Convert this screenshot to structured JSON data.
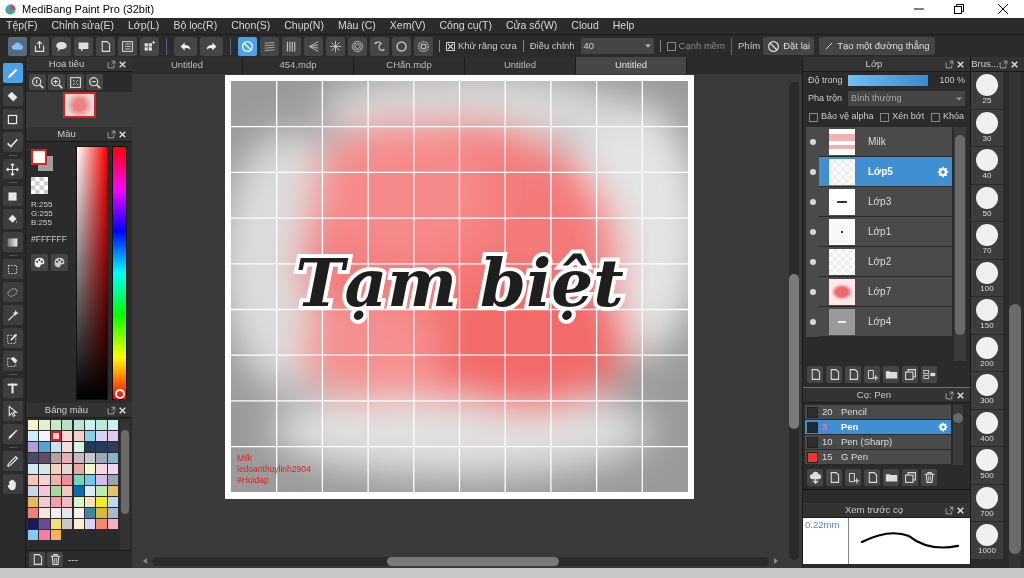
{
  "window": {
    "title": "MediBang Paint Pro (32bit)"
  },
  "menu": [
    "Tệp(F)",
    "Chỉnh sửa(E)",
    "Lớp(L)",
    "Bộ lọc(R)",
    "Chọn(S)",
    "Chụp(N)",
    "Màu (C)",
    "Xem(V)",
    "Công cụ(T)",
    "Cửa sổ(W)",
    "Cloud",
    "Help"
  ],
  "toolbar": {
    "rulers": [
      {
        "selected": true
      },
      {
        "selected": false
      },
      {
        "selected": false
      },
      {
        "selected": false
      },
      {
        "selected": false
      },
      {
        "selected": false
      },
      {
        "selected": false
      },
      {
        "selected": false
      },
      {
        "selected": false
      }
    ],
    "antialias": {
      "label": "Khử răng cưa",
      "checked": true
    },
    "adjust": {
      "label": "Điều chỉnh",
      "value": "40"
    },
    "soft_edge": {
      "label": "Cạnh mềm",
      "checked": false
    },
    "keys_label": "Phím",
    "reset_button": "Đặt lại",
    "line_button": "Tạo một đường thẳng"
  },
  "tools": [
    {
      "selected": true
    },
    {
      "selected": false
    },
    {
      "selected": false
    },
    {
      "selected": false
    },
    {
      "selected": false
    },
    {
      "selected": false
    },
    {
      "selected": false
    },
    {
      "selected": false
    },
    {
      "selected": false
    },
    {
      "selected": false
    },
    {
      "selected": false
    },
    {
      "selected": false
    },
    {
      "selected": false
    },
    {
      "selected": false
    },
    {
      "selected": false
    },
    {
      "selected": false
    },
    {
      "selected": false
    },
    {
      "selected": false
    }
  ],
  "navigator": {
    "title": "Hoa tiêu"
  },
  "color": {
    "title": "Màu",
    "r": "R:255",
    "g": "G:255",
    "b": "B:255",
    "hex": "#FFFFFF",
    "hue_slider": {
      "level": 0
    }
  },
  "palette": {
    "title": "Bảng màu",
    "footer": "---",
    "swatches": [
      {
        "color": "#fbf6c9",
        "selected": false
      },
      {
        "color": "#e3f0cf",
        "selected": false
      },
      {
        "color": "#cde8c6",
        "selected": false
      },
      {
        "color": "#b8e0c4",
        "selected": false
      },
      {
        "color": "#bfe6cf",
        "selected": false
      },
      {
        "color": "#c9f1f4",
        "selected": false
      },
      {
        "color": "#b9e9d8",
        "selected": false
      },
      {
        "color": "#cdeef5",
        "selected": false
      },
      {
        "color": "#cdeef9",
        "selected": false
      },
      {
        "color": "#f7f0f8",
        "selected": false
      },
      {
        "color": "#f9d0de",
        "selected": true
      },
      {
        "color": "#f9d9d9",
        "selected": false
      },
      {
        "color": "#f6cfcf",
        "selected": false
      },
      {
        "color": "#8ad0ec",
        "selected": false
      },
      {
        "color": "#d9d2f2",
        "selected": false
      },
      {
        "color": "#e5c8f0",
        "selected": false
      },
      {
        "color": "#b0a0d8",
        "selected": false
      },
      {
        "color": "#4fa4d9",
        "selected": false
      },
      {
        "color": "#c4e4f5",
        "selected": false
      },
      {
        "color": "#f6d8e2",
        "selected": false
      },
      {
        "color": "#d8f4e6",
        "selected": false
      },
      {
        "color": "#1e3a55",
        "selected": false
      },
      {
        "color": "#213c5c",
        "selected": false
      },
      {
        "color": "#2e3d5a",
        "selected": false
      },
      {
        "color": "#4a4a66",
        "selected": false
      },
      {
        "color": "#5f4a6a",
        "selected": false
      },
      {
        "color": "#b59fa6",
        "selected": false
      },
      {
        "color": "#e4b0b0",
        "selected": false
      },
      {
        "color": "#c9b8c0",
        "selected": false
      },
      {
        "color": "#c2c7d0",
        "selected": false
      },
      {
        "color": "#9fa6b8",
        "selected": false
      },
      {
        "color": "#8fb0cc",
        "selected": false
      },
      {
        "color": "#cfeaf4",
        "selected": false
      },
      {
        "color": "#d8e6e8",
        "selected": false
      },
      {
        "color": "#f6d2bc",
        "selected": false
      },
      {
        "color": "#e6d6d2",
        "selected": false
      },
      {
        "color": "#e6a8a0",
        "selected": false
      },
      {
        "color": "#f2f8d0",
        "selected": false
      },
      {
        "color": "#f6d6e4",
        "selected": false
      },
      {
        "color": "#efd6f4",
        "selected": false
      },
      {
        "color": "#f6c8b4",
        "selected": false
      },
      {
        "color": "#f8d2d2",
        "selected": false
      },
      {
        "color": "#f2b0b0",
        "selected": false
      },
      {
        "color": "#f08ca0",
        "selected": false
      },
      {
        "color": "#74d6c0",
        "selected": false
      },
      {
        "color": "#74c8e8",
        "selected": false
      },
      {
        "color": "#d8b8f0",
        "selected": false
      },
      {
        "color": "#9aa4b4",
        "selected": false
      },
      {
        "color": "#c8d6ec",
        "selected": false
      },
      {
        "color": "#f8c4d6",
        "selected": false
      },
      {
        "color": "#aad89a",
        "selected": false
      },
      {
        "color": "#f6c6c0",
        "selected": false
      },
      {
        "color": "#0b6db0",
        "selected": false
      },
      {
        "color": "#d8ecf8",
        "selected": false
      },
      {
        "color": "#b8ecb0",
        "selected": false
      },
      {
        "color": "#e6c06a",
        "selected": false
      },
      {
        "color": "#e8b860",
        "selected": false
      },
      {
        "color": "#f8c8d0",
        "selected": false
      },
      {
        "color": "#f2a0a8",
        "selected": false
      },
      {
        "color": "#f4b8c0",
        "selected": false
      },
      {
        "color": "#d8f6c8",
        "selected": false
      },
      {
        "color": "#fae0b8",
        "selected": false
      },
      {
        "color": "#f4ee20",
        "selected": false
      },
      {
        "color": "#b8d8f4",
        "selected": false
      },
      {
        "color": "#f08078",
        "selected": false
      },
      {
        "color": "#f8e4e0",
        "selected": false
      },
      {
        "color": "#f4f0f2",
        "selected": false
      },
      {
        "color": "#e6e4ec",
        "selected": false
      },
      {
        "color": "#f8f0f4",
        "selected": false
      },
      {
        "color": "#3a88a8",
        "selected": false
      },
      {
        "color": "#e0b830",
        "selected": false
      },
      {
        "color": "#a8b8d0",
        "selected": false
      },
      {
        "color": "#1a1a5a",
        "selected": false
      },
      {
        "color": "#6a4a98",
        "selected": false
      },
      {
        "color": "#f6e070",
        "selected": false
      },
      {
        "color": "#c8c8c8",
        "selected": false
      },
      {
        "color": "#f8f0d0",
        "selected": false
      },
      {
        "color": "#d8d0f8",
        "selected": false
      },
      {
        "color": "#f88870",
        "selected": false
      },
      {
        "color": "#f4b0c8",
        "selected": false
      },
      {
        "color": "#88c8f4",
        "selected": false
      },
      {
        "color": "#f080a8",
        "selected": false
      },
      {
        "color": "#f8b050",
        "selected": false
      }
    ]
  },
  "tabs": [
    {
      "label": "Untitled",
      "selected": false
    },
    {
      "label": "454.mdp",
      "selected": false
    },
    {
      "label": "CHấn.mdp",
      "selected": false
    },
    {
      "label": "Untitled",
      "selected": false
    },
    {
      "label": "Untitled",
      "selected": true
    }
  ],
  "canvas": {
    "title_art": "Tạm biệt",
    "signature": [
      "Milk",
      "ledoanthuylinh2904",
      "#Hoidap"
    ]
  },
  "layers": {
    "title": "Lớp",
    "opacity": {
      "label": "Độ trong",
      "level": 1,
      "reading": "100 %"
    },
    "blend": {
      "label": "Pha trộn",
      "value": "Bình thường"
    },
    "options": [
      {
        "label": "Bảo vệ alpha",
        "checked": false
      },
      {
        "label": "Xén bớt",
        "checked": false
      },
      {
        "label": "Khóa",
        "checked": false
      }
    ],
    "items": [
      {
        "name": "Milk",
        "selected": false,
        "kind": "banner"
      },
      {
        "name": "Lớp5",
        "selected": true,
        "kind": "blank"
      },
      {
        "name": "Lớp3",
        "selected": false,
        "kind": "text"
      },
      {
        "name": "Lớp1",
        "selected": false,
        "kind": "dot"
      },
      {
        "name": "Lớp2",
        "selected": false,
        "kind": "blank"
      },
      {
        "name": "Lớp7",
        "selected": false,
        "kind": "red"
      },
      {
        "name": "Lớp4",
        "selected": false,
        "kind": "gray"
      }
    ]
  },
  "brushes": {
    "title": "Cọ: Pen",
    "items": [
      {
        "size": "20",
        "name": "Pencil",
        "color": "#2f2f2f",
        "selected": false
      },
      {
        "size": "3",
        "name": "Pen",
        "color": "#1e2a38",
        "selected": true
      },
      {
        "size": "10",
        "name": "Pen (Sharp)",
        "color": "#2f2f2f",
        "selected": false
      },
      {
        "size": "15",
        "name": "G Pen",
        "color": "#ff3030",
        "selected": false
      }
    ]
  },
  "brush_sizes": {
    "title": "Brus...",
    "items": [
      "25",
      "30",
      "40",
      "50",
      "70",
      "100",
      "150",
      "200",
      "300",
      "400",
      "500",
      "700",
      "1000"
    ]
  },
  "preview": {
    "title": "Xem trước cọ",
    "size": "0.22mm"
  }
}
